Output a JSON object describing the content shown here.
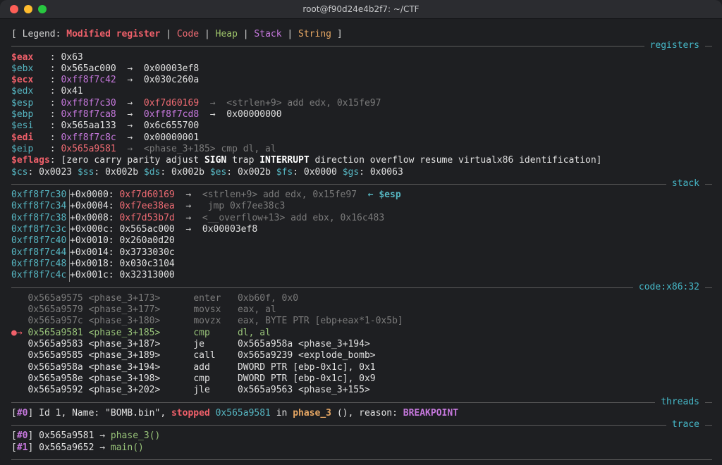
{
  "window": {
    "title": "root@f90d24e4b2f7: ~/CTF"
  },
  "legend": {
    "open": "[ Legend: ",
    "modified": "Modified register",
    "bar": " | ",
    "code": "Code",
    "heap": "Heap",
    "stack": "Stack",
    "string": "String",
    "close": " ]"
  },
  "sections": {
    "registers": "registers",
    "stack": "stack",
    "code": "code:x86:32",
    "threads": "threads",
    "trace": "trace"
  },
  "registers": {
    "eax": {
      "name": "$eax   ",
      "sep": ": ",
      "value": "0x63"
    },
    "ebx": {
      "name": "$ebx   ",
      "sep": ": ",
      "value": "0x565ac000",
      "arrow": "  →  ",
      "target": "0x00003ef8"
    },
    "ecx": {
      "name": "$ecx   ",
      "sep": ": ",
      "value": "0xff8f7c42",
      "arrow": "  →  ",
      "target": "0x030c260a"
    },
    "edx": {
      "name": "$edx   ",
      "sep": ": ",
      "value": "0x41"
    },
    "esp": {
      "name": "$esp   ",
      "sep": ": ",
      "value": "0xff8f7c30",
      "arrow": "  →  ",
      "target": "0xf7d60169",
      "arrow2": "  →  ",
      "sym": "<strlen+9> add edx, 0x15fe97"
    },
    "ebp": {
      "name": "$ebp   ",
      "sep": ": ",
      "value": "0xff8f7ca8",
      "arrow": "  →  ",
      "target": "0xff8f7cd8",
      "arrow2": "  →  ",
      "target2": "0x00000000"
    },
    "esi": {
      "name": "$esi   ",
      "sep": ": ",
      "value": "0x565aa133",
      "arrow": "  →  ",
      "target": "0x6c655700"
    },
    "edi": {
      "name": "$edi   ",
      "sep": ": ",
      "value": "0xff8f7c8c",
      "arrow": "  →  ",
      "target": "0x00000001"
    },
    "eip": {
      "name": "$eip   ",
      "sep": ": ",
      "value": "0x565a9581",
      "arrow": "  →  ",
      "sym": "<phase_3+185> cmp dl, al"
    },
    "eflags": {
      "name": "$eflags",
      "pre": ": [zero carry parity adjust ",
      "sign": "SIGN",
      "mid": " trap ",
      "interrupt": "INTERRUPT",
      "post": " direction overflow resume virtualx86 identification]"
    },
    "segs": [
      {
        "name": "$cs",
        "value": ": 0x0023 "
      },
      {
        "name": "$ss",
        "value": ": 0x002b "
      },
      {
        "name": "$ds",
        "value": ": 0x002b "
      },
      {
        "name": "$es",
        "value": ": 0x002b "
      },
      {
        "name": "$fs",
        "value": ": 0x0000 "
      },
      {
        "name": "$gs",
        "value": ": 0x0063"
      }
    ]
  },
  "stack": [
    {
      "addr": "0xff8f7c30",
      "off": "+0x0000: ",
      "val": "0xf7d60169",
      "arrow": "  →  ",
      "sym": "<strlen+9> add edx, 0x15fe97",
      "tag": "  ← $esp"
    },
    {
      "addr": "0xff8f7c34",
      "off": "+0x0004: ",
      "val": "0xf7ee38ea",
      "arrow": "  →   ",
      "sym": "jmp 0xf7ee38c3"
    },
    {
      "addr": "0xff8f7c38",
      "off": "+0x0008: ",
      "val": "0xf7d53b7d",
      "arrow": "  →  ",
      "sym": "<__overflow+13> add ebx, 0x16c483"
    },
    {
      "addr": "0xff8f7c3c",
      "off": "+0x000c: ",
      "val": "0x565ac000",
      "arrow": "  →  ",
      "sym": "0x00003ef8"
    },
    {
      "addr": "0xff8f7c40",
      "off": "+0x0010: ",
      "val": "0x260a0d20"
    },
    {
      "addr": "0xff8f7c44",
      "off": "+0x0014: ",
      "val": "0x3733030c"
    },
    {
      "addr": "0xff8f7c48",
      "off": "+0x0018: ",
      "val": "0x030c3104"
    },
    {
      "addr": "0xff8f7c4c",
      "off": "+0x001c: ",
      "val": "0x32313000"
    }
  ],
  "code": [
    {
      "prefix": "   ",
      "addr": "0x565a9575",
      "sym": "<phase_3+173>",
      "mn": "enter",
      "ops": "0xb60f, 0x0",
      "state": "past"
    },
    {
      "prefix": "   ",
      "addr": "0x565a9579",
      "sym": "<phase_3+177>",
      "mn": "movsx",
      "ops": "eax, al",
      "state": "past"
    },
    {
      "prefix": "   ",
      "addr": "0x565a957c",
      "sym": "<phase_3+180>",
      "mn": "movzx",
      "ops": "eax, BYTE PTR [ebp+eax*1-0x5b]",
      "state": "past"
    },
    {
      "prefix": "●→ ",
      "addr": "0x565a9581",
      "sym": "<phase_3+185>",
      "mn": "cmp",
      "ops": "dl, al",
      "state": "current"
    },
    {
      "prefix": "   ",
      "addr": "0x565a9583",
      "sym": "<phase_3+187>",
      "mn": "je",
      "ops": "0x565a958a <phase_3+194>",
      "state": "next"
    },
    {
      "prefix": "   ",
      "addr": "0x565a9585",
      "sym": "<phase_3+189>",
      "mn": "call",
      "ops": "0x565a9239 <explode_bomb>",
      "state": "next"
    },
    {
      "prefix": "   ",
      "addr": "0x565a958a",
      "sym": "<phase_3+194>",
      "mn": "add",
      "ops": "DWORD PTR [ebp-0x1c], 0x1",
      "state": "next"
    },
    {
      "prefix": "   ",
      "addr": "0x565a958e",
      "sym": "<phase_3+198>",
      "mn": "cmp",
      "ops": "DWORD PTR [ebp-0x1c], 0x9",
      "state": "next"
    },
    {
      "prefix": "   ",
      "addr": "0x565a9592",
      "sym": "<phase_3+202>",
      "mn": "jle",
      "ops": "0x565a9563 <phase_3+155>",
      "state": "next"
    }
  ],
  "thread": {
    "open": "[",
    "id": "#0",
    "close": "] ",
    "info": "Id 1, Name: \"BOMB.bin\", ",
    "stopped": "stopped",
    "sp": " ",
    "addr": "0x565a9581",
    "in": " in ",
    "fn": "phase_3",
    "reason_pre": " (), reason: ",
    "reason": "BREAKPOINT"
  },
  "trace": [
    {
      "open": "[",
      "id": "#0",
      "close": "] ",
      "addr": "0x565a9581",
      "arrow": " → ",
      "fn": "phase_3()"
    },
    {
      "open": "[",
      "id": "#1",
      "close": "] ",
      "addr": "0x565a9652",
      "arrow": " → ",
      "fn": "main()"
    }
  ],
  "colors": {
    "background": "#1e1f22",
    "modified": "#f0606a",
    "register": "#56b6c2",
    "pointer": "#c678dd",
    "code": "#ef6b73",
    "heap": "#9ec46a",
    "string": "#e5a663"
  }
}
